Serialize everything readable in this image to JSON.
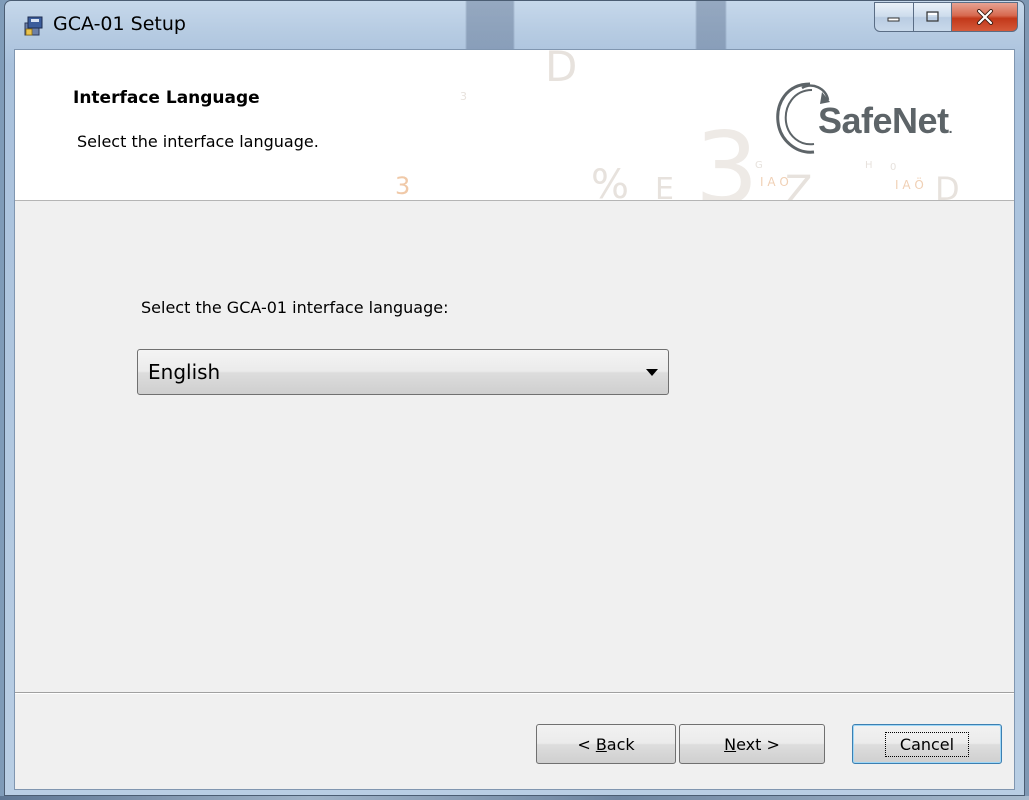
{
  "window": {
    "title": "GCA-01 Setup"
  },
  "banner": {
    "title": "Interface Language",
    "subtitle": "Select the interface language.",
    "logo_text": "SafeNet",
    "logo_suffix": "."
  },
  "main": {
    "prompt": "Select the GCA-01 interface language:",
    "language_select": {
      "selected": "English"
    }
  },
  "buttons": {
    "back_prefix": "< ",
    "back_accel": "B",
    "back_rest": "ack",
    "next_accel": "N",
    "next_rest": "ext >",
    "cancel": "Cancel"
  },
  "icons": {
    "app": "installer-icon",
    "minimize": "minimize-icon",
    "maximize": "maximize-icon",
    "close": "close-icon"
  },
  "colors": {
    "close_button": "#c2381a",
    "logo_gray": "#5d6468",
    "focus_border": "#3c7fb1"
  }
}
